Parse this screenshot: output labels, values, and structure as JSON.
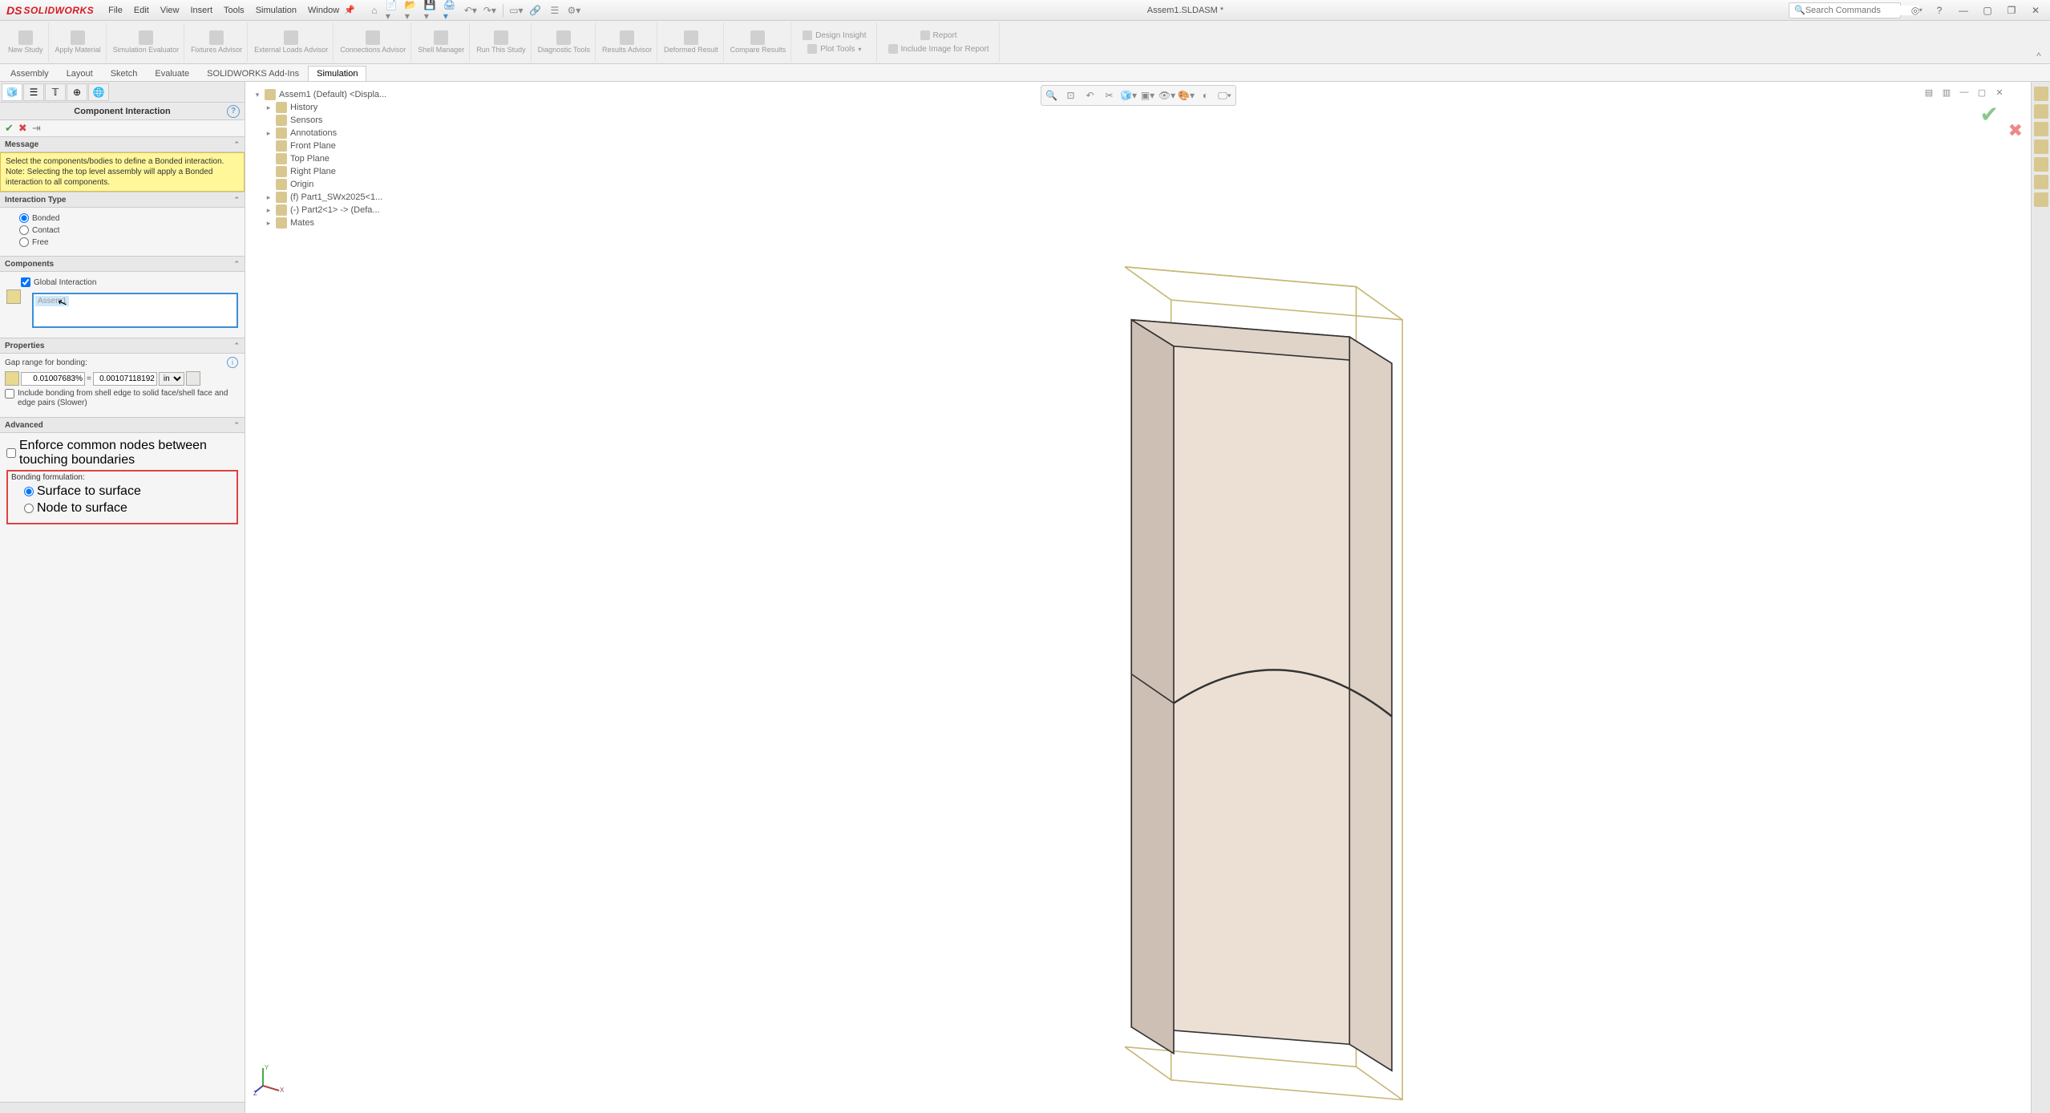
{
  "app": {
    "name": "SOLIDWORKS",
    "title": "Assem1.SLDASM *",
    "search_placeholder": "Search Commands"
  },
  "menu": [
    "File",
    "Edit",
    "View",
    "Insert",
    "Tools",
    "Simulation",
    "Window"
  ],
  "ribbon": [
    {
      "label": "New Study"
    },
    {
      "label": "Apply Material"
    },
    {
      "label": "Simulation Evaluator"
    },
    {
      "label": "Fixtures Advisor"
    },
    {
      "label": "External Loads Advisor"
    },
    {
      "label": "Connections Advisor"
    },
    {
      "label": "Shell Manager"
    },
    {
      "label": "Run This Study"
    },
    {
      "label": "Diagnostic Tools"
    },
    {
      "label": "Results Advisor"
    },
    {
      "label": "Deformed Result"
    },
    {
      "label": "Compare Results"
    }
  ],
  "ribbon_right": {
    "design_insight": "Design Insight",
    "plot_tools": "Plot Tools",
    "report": "Report",
    "include_image": "Include Image for Report"
  },
  "cmd_tabs": [
    "Assembly",
    "Layout",
    "Sketch",
    "Evaluate",
    "SOLIDWORKS Add-Ins",
    "Simulation"
  ],
  "cmd_tabs_active": 5,
  "panel": {
    "title": "Component Interaction",
    "message": {
      "header": "Message",
      "text": "Select the components/bodies to define a Bonded interaction. Note: Selecting the top level assembly will apply a Bonded interaction to all components."
    },
    "interaction": {
      "header": "Interaction Type",
      "options": [
        "Bonded",
        "Contact",
        "Free"
      ],
      "selected": "Bonded"
    },
    "components": {
      "header": "Components",
      "global": "Global Interaction",
      "global_checked": true,
      "selected_item": "Assem1"
    },
    "properties": {
      "header": "Properties",
      "gap_label": "Gap range for bonding:",
      "percent": "0.01007683%",
      "value": "0.00107118192",
      "unit": "in",
      "include_shell": "Include bonding from shell edge to solid face/shell face and edge pairs (Slower)"
    },
    "advanced": {
      "header": "Advanced",
      "enforce": "Enforce common nodes between touching boundaries",
      "bonding_label": "Bonding formulation:",
      "opt1": "Surface to surface",
      "opt2": "Node to surface"
    }
  },
  "tree": [
    {
      "level": 0,
      "label": "Assem1 (Default) <Displa...",
      "exp": "▾"
    },
    {
      "level": 1,
      "label": "History",
      "exp": "▸"
    },
    {
      "level": 1,
      "label": "Sensors",
      "exp": ""
    },
    {
      "level": 1,
      "label": "Annotations",
      "exp": "▸"
    },
    {
      "level": 1,
      "label": "Front Plane",
      "exp": ""
    },
    {
      "level": 1,
      "label": "Top Plane",
      "exp": ""
    },
    {
      "level": 1,
      "label": "Right Plane",
      "exp": ""
    },
    {
      "level": 1,
      "label": "Origin",
      "exp": ""
    },
    {
      "level": 1,
      "label": "(f) Part1_SWx2025<1...",
      "exp": "▸"
    },
    {
      "level": 1,
      "label": "(-) Part2<1> -> (Defa...",
      "exp": "▸"
    },
    {
      "level": 1,
      "label": "Mates",
      "exp": "▸"
    }
  ]
}
